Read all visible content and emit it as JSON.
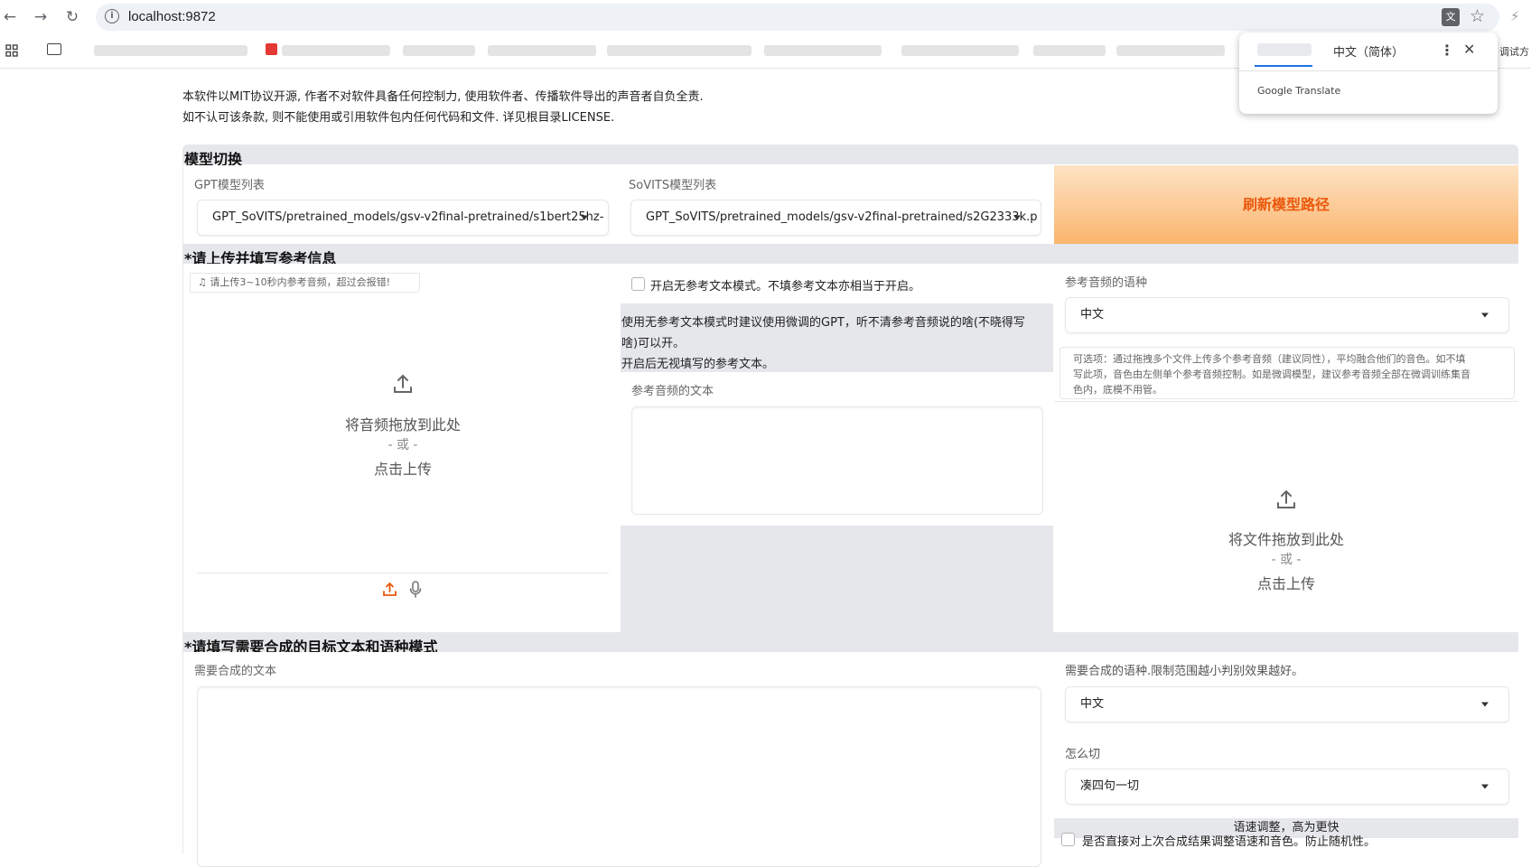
{
  "browser": {
    "url": "localhost:9872",
    "bookmarks_trailing": "调试方"
  },
  "translate_popup": {
    "target_language": "中文（简体）",
    "provider": "Google Translate"
  },
  "notice": {
    "line1": "本软件以MIT协议开源, 作者不对软件具备任何控制力, 使用软件者、传播软件导出的声音者自负全责.",
    "line2": "如不认可该条款, 则不能使用或引用软件包内任何代码和文件. 详见根目录LICENSE."
  },
  "model_switch": {
    "title": "模型切换",
    "gpt_label": "GPT模型列表",
    "gpt_value": "GPT_SoVITS/pretrained_models/gsv-v2final-pretrained/s1bert25hz-",
    "sovits_label": "SoVITS模型列表",
    "sovits_value": "GPT_SoVITS/pretrained_models/gsv-v2final-pretrained/s2G2333k.p",
    "refresh_button": "刷新模型路径"
  },
  "reference": {
    "title": "*请上传并填写参考信息",
    "audio_hint": "请上传3~10秒内参考音频，超过会报错!",
    "upload_line1": "将音频拖放到此处",
    "upload_or": "- 或 -",
    "upload_line2": "点击上传",
    "no_ref_checkbox": "开启无参考文本模式。不填参考文本亦相当于开启。",
    "no_ref_note1": "使用无参考文本模式时建议使用微调的GPT，听不清参考音频说的啥(不晓得写",
    "no_ref_note2": "啥)可以开。",
    "no_ref_note3": "开启后无视填写的参考文本。",
    "ref_text_label": "参考音频的文本",
    "ref_lang_label": "参考音频的语种",
    "ref_lang_value": "中文",
    "optional_note1": "可选项：通过拖拽多个文件上传多个参考音频（建议同性），平均融合他们的音色。如不填",
    "optional_note2": "写此项，音色由左侧单个参考音频控制。如是微调模型，建议参考音频全部在微调训练集音",
    "optional_note3": "色内，底模不用管。",
    "files_upload_line1": "将文件拖放到此处",
    "files_upload_or": "- 或 -",
    "files_upload_line2": "点击上传"
  },
  "target": {
    "title": "*请填写需要合成的目标文本和语种模式",
    "text_label": "需要合成的文本",
    "lang_label": "需要合成的语种.限制范围越小判别效果越好。",
    "lang_value": "中文",
    "cut_label": "怎么切",
    "cut_value": "凑四句一切",
    "speed_title": "语速调整，高为更快",
    "direct_adjust_checkbox": "是否直接对上次合成结果调整语速和音色。防止随机性。"
  },
  "colors": {
    "accent_orange": "#ea580c",
    "refresh_gradient_top": "#fde3c4",
    "refresh_gradient_bottom": "#fbb56e",
    "section_gray": "#e5e7eb"
  }
}
